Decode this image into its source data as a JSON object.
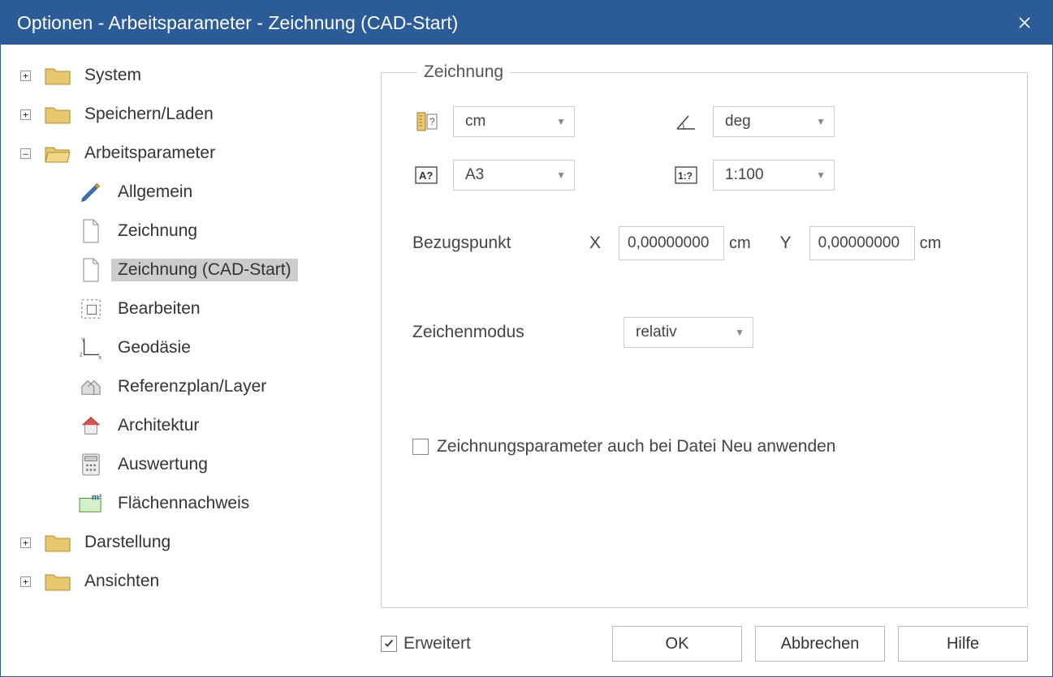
{
  "title": "Optionen - Arbeitsparameter - Zeichnung (CAD-Start)",
  "tree": {
    "system": "System",
    "speichern": "Speichern/Laden",
    "arbeitsparameter": "Arbeitsparameter",
    "children": {
      "allgemein": "Allgemein",
      "zeichnung": "Zeichnung",
      "zeichnung_cad": "Zeichnung (CAD-Start)",
      "bearbeiten": "Bearbeiten",
      "geodasie": "Geodäsie",
      "referenzplan": "Referenzplan/Layer",
      "architektur": "Architektur",
      "auswertung": "Auswertung",
      "flachennachweis": "Flächennachweis"
    },
    "darstellung": "Darstellung",
    "ansichten": "Ansichten"
  },
  "group": {
    "legend": "Zeichnung",
    "unit_length": "cm",
    "unit_angle": "deg",
    "paper_format": "A3",
    "scale": "1:100",
    "bezugspunkt_label": "Bezugspunkt",
    "x_label": "X",
    "y_label": "Y",
    "x_value": "0,00000000",
    "y_value": "0,00000000",
    "x_unit": "cm",
    "y_unit": "cm",
    "zeichenmodus_label": "Zeichenmodus",
    "zeichenmodus_value": "relativ",
    "apply_on_new_label": "Zeichnungsparameter auch bei Datei Neu anwenden"
  },
  "footer": {
    "erweitert": "Erweitert",
    "ok": "OK",
    "abbrechen": "Abbrechen",
    "hilfe": "Hilfe"
  }
}
